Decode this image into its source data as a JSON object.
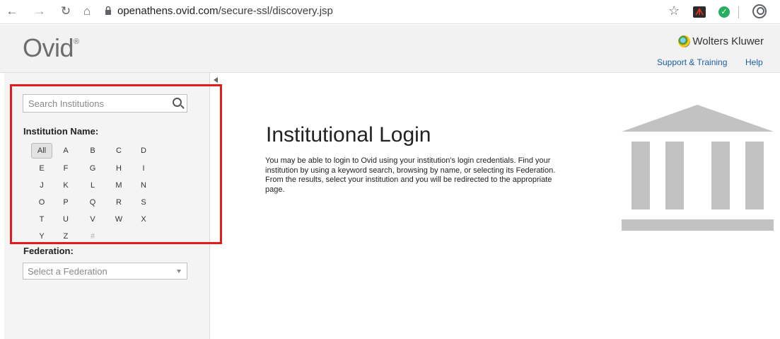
{
  "browser": {
    "url_domain": "openathens.ovid.com",
    "url_path": "/secure-ssl/discovery.jsp"
  },
  "header": {
    "logo_text": "Ovid",
    "logo_mark": "®",
    "company": "Wolters Kluwer",
    "support_link": "Support & Training",
    "help_link": "Help"
  },
  "sidebar": {
    "search_placeholder": "Search Institutions",
    "institution_label": "Institution Name:",
    "letters": [
      "All",
      "A",
      "B",
      "C",
      "D",
      "E",
      "F",
      "G",
      "H",
      "I",
      "J",
      "K",
      "L",
      "M",
      "N",
      "O",
      "P",
      "Q",
      "R",
      "S",
      "T",
      "U",
      "V",
      "W",
      "X",
      "Y",
      "Z",
      "#"
    ],
    "active_letter": "All",
    "federation_label": "Federation:",
    "federation_placeholder": "Select a Federation"
  },
  "main": {
    "title": "Institutional Login",
    "description": "You may be able to login to Ovid using your institution's login credentials. Find your institution by using a keyword search, browsing by name, or selecting its Federation. From the results, select your institution and you will be redirected to the appropriate page."
  },
  "icons": {
    "institution": "building-icon",
    "search": "search-icon"
  },
  "colors": {
    "link": "#1a5fa8",
    "highlight_box": "#e21b1b",
    "building": "#c2c2c2"
  }
}
